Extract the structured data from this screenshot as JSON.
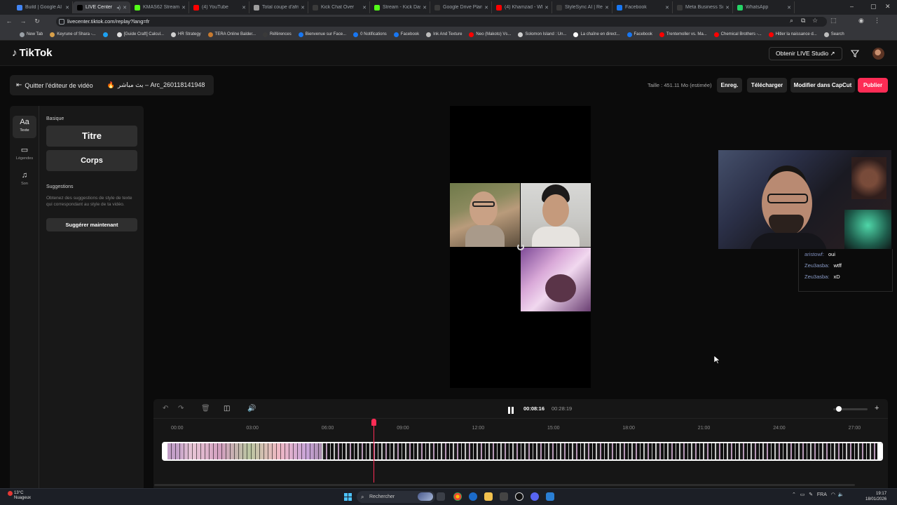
{
  "browser": {
    "tabs": [
      {
        "title": "Build | Google AI S",
        "color": "#4285f4"
      },
      {
        "title": "LIVE Center",
        "color": "#000000",
        "active": true
      },
      {
        "title": "KMAS62 Stream -",
        "color": "#53fc18"
      },
      {
        "title": "(4) YouTube",
        "color": "#ff0000"
      },
      {
        "title": "Total coupe d'afric",
        "color": "#9e9e9e"
      },
      {
        "title": "Kick Chat Over",
        "color": "#3a3a3a"
      },
      {
        "title": "Stream - Kick Dash",
        "color": "#53fc18"
      },
      {
        "title": "Google Drive Plans",
        "color": "#3a3a3a"
      },
      {
        "title": "(4) Khamzad - Wh",
        "color": "#ff0000"
      },
      {
        "title": "StyleSync AI | Rest",
        "color": "#3a3a3a"
      },
      {
        "title": "Facebook",
        "color": "#1877f2"
      },
      {
        "title": "Meta Business Suite",
        "color": "#3a3a3a"
      },
      {
        "title": "WhatsApp",
        "color": "#25d366"
      }
    ],
    "url": "livecenter.tiktok.com/replay?lang=fr",
    "bookmarks": [
      {
        "label": "New Tab",
        "color": "#9aa0a6"
      },
      {
        "label": "Keyrune of Shara -...",
        "color": "#d8a04a"
      },
      {
        "label": "",
        "color": "#1da1f2"
      },
      {
        "label": "[Guide Craft] Calcul...",
        "color": "#e0e0e0"
      },
      {
        "label": "HR Strategy",
        "color": "#cfcfcf"
      },
      {
        "label": "TERA Online Balder...",
        "color": "#c77a2f"
      },
      {
        "label": "Références",
        "color": "#3a3a3a"
      },
      {
        "label": "Bienvenue sur Face...",
        "color": "#1877f2"
      },
      {
        "label": "0 Notifications",
        "color": "#1877f2"
      },
      {
        "label": "Facebook",
        "color": "#1877f2"
      },
      {
        "label": "Ink And Texture",
        "color": "#bdbdbd"
      },
      {
        "label": "Neo (Makoto) Vs...",
        "color": "#ff0000"
      },
      {
        "label": "Solomon Island : Un...",
        "color": "#cfcfcf"
      },
      {
        "label": "La chaîne en direct...",
        "color": "#ffffff"
      },
      {
        "label": "Facebook",
        "color": "#1877f2"
      },
      {
        "label": "Trentemoller vs. Ma...",
        "color": "#ff0000"
      },
      {
        "label": "Chemical Brothers -...",
        "color": "#ff0000"
      },
      {
        "label": "Hitler la naissance d...",
        "color": "#ff0000"
      },
      {
        "label": "Search",
        "color": "#bdbdbd"
      }
    ]
  },
  "header": {
    "logo": "TikTok",
    "live_studio": "Obtenir LIVE Studio ↗"
  },
  "editor": {
    "quit_label": "Quitter l'éditeur de vidéo",
    "video_title": "بث مباشر – Arc_260118141948",
    "size_text": "Taille : 451.11 Mo (estimée)",
    "buttons": {
      "save": "Enreg.",
      "download": "Télécharger",
      "capcut": "Modifier dans CapCut",
      "publish": "Publier"
    }
  },
  "panel": {
    "tabs": [
      {
        "icon": "Aa",
        "label": "Texte"
      },
      {
        "icon": "▭",
        "label": "Légendes"
      },
      {
        "icon": "♫",
        "label": "Son"
      }
    ],
    "basic_label": "Basique",
    "title_btn": "Titre",
    "body_btn": "Corps",
    "suggestions_label": "Suggestions",
    "suggestions_desc": "Obtenez des suggestions de style de texte qui correspondant au style de ta vidéo.",
    "suggest_btn": "Suggérer maintenant"
  },
  "chat": [
    {
      "user": "aristowf:",
      "msg": "oui"
    },
    {
      "user": "Zeu3asba:",
      "msg": "wtff"
    },
    {
      "user": "Zeu3asba:",
      "msg": "xD"
    }
  ],
  "timeline": {
    "current_time": "00:08:16",
    "total_time": "00:28:19",
    "ticks": [
      "00:00",
      "03:00",
      "06:00",
      "09:00",
      "12:00",
      "15:00",
      "18:00",
      "21:00",
      "24:00",
      "27:00"
    ],
    "playhead_seconds": 496,
    "duration_seconds": 1699
  },
  "taskbar": {
    "weather_temp": "13°C",
    "weather_desc": "Nuageux",
    "search_placeholder": "Rechercher",
    "lang": "FRA",
    "time": "19:17",
    "date": "18/01/2026"
  },
  "colors": {
    "accent": "#fe2c55",
    "panel_bg": "#181818"
  }
}
